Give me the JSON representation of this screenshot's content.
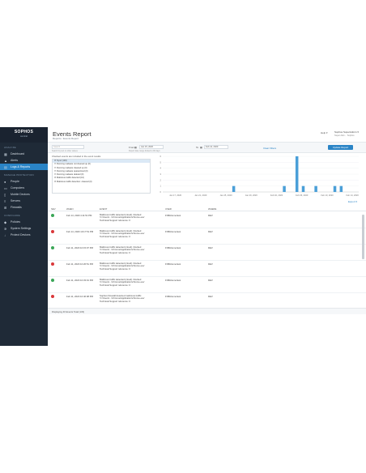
{
  "app": {
    "brand": "SOPHOS",
    "brand_sub": "central"
  },
  "sidebar": {
    "section1": "ANALYZE",
    "section2": "MANAGE PROTECTION",
    "section3": "CONFIGURE",
    "items": [
      {
        "label": "Dashboard",
        "icon": "dashboard-icon",
        "active": false
      },
      {
        "label": "Alerts",
        "icon": "alert-icon",
        "active": false
      },
      {
        "label": "Logs & Reports",
        "icon": "reports-icon",
        "active": true
      },
      {
        "label": "People",
        "icon": "people-icon",
        "active": false
      },
      {
        "label": "Computers",
        "icon": "computer-icon",
        "active": false
      },
      {
        "label": "Mobile Devices",
        "icon": "mobile-icon",
        "active": false
      },
      {
        "label": "Servers",
        "icon": "server-icon",
        "active": false
      },
      {
        "label": "Firewalls",
        "icon": "firewall-icon",
        "active": false
      },
      {
        "label": "Policies",
        "icon": "policy-icon",
        "active": false
      },
      {
        "label": "System Settings",
        "icon": "gear-icon",
        "active": false
      },
      {
        "label": "Protect Devices",
        "icon": "download-icon",
        "active": false
      }
    ]
  },
  "header": {
    "title": "Events Report",
    "crumb1": "Reports",
    "crumb2": "Events Report",
    "help": "Help ▾",
    "user": "Sophos SuperAdmin ▾",
    "user_role": "Super Adm... Sophos"
  },
  "filters": {
    "search_placeholder": "Search",
    "search_hint": "Search by text or other values",
    "from_label": "From",
    "from_date": "Jan 15, 2020",
    "to_label": "To",
    "to_date": "Feb 14, 2020",
    "range_hint": "Report date range limited to 90 days",
    "clear": "Clear Filters",
    "update_button": "Update Report"
  },
  "event_types": {
    "heading": "Checked events are included in the event results",
    "items": [
      {
        "label": "Sync (133)",
        "selected": true
      },
      {
        "label": "Running malware not cleaned up (0)",
        "selected": false
      },
      {
        "label": "Running malware cleaned up (0)",
        "selected": false
      },
      {
        "label": "Running malware quarantined (0)",
        "selected": false
      },
      {
        "label": "Running malware deleted (0)",
        "selected": false
      },
      {
        "label": "Malicious traffic detected (10)",
        "selected": false
      },
      {
        "label": "Malicious traffic detection: cleaned (0)",
        "selected": false
      }
    ]
  },
  "chart_data": {
    "type": "bar",
    "ylim": [
      0,
      6
    ],
    "yticks": [
      "6",
      "5",
      "4",
      "3",
      "2",
      "1",
      "0"
    ],
    "tick_labels": [
      "Jan 17, 2020",
      "Jan 21, 2020",
      "Jan 25, 2020",
      "Jan 29, 2020",
      "Feb 02, 2020",
      "Feb 06, 2020",
      "Feb 10, 2020",
      "Feb 14, 2020"
    ],
    "values": [
      {
        "x": "Jan 26, 2020",
        "y": 1
      },
      {
        "x": "Feb 03, 2020",
        "y": 1
      },
      {
        "x": "Feb 05, 2020",
        "y": 6
      },
      {
        "x": "Feb 06, 2020",
        "y": 1
      },
      {
        "x": "Feb 08, 2020",
        "y": 1
      },
      {
        "x": "Feb 11, 2020",
        "y": 1
      },
      {
        "x": "Feb 12, 2020",
        "y": 1
      }
    ],
    "bar_color": "#4a9fd8",
    "grid": true
  },
  "table": {
    "refresh": "Export ▾",
    "columns": [
      "SEV",
      "WHEN",
      "EVENT",
      "USER",
      "WHERE"
    ],
    "rows": [
      {
        "status": "green",
        "when": "Feb 14, 2020 4:11:51 PM",
        "event": "Malicious traffic detected (cloud). blocked 'C:\\Users\\...\\Chrome\\Application\\chrome.exe' Technical Support reference: 0",
        "user": "FNB-Demo\\test",
        "where": "DEV"
      },
      {
        "status": "red",
        "when": "Feb 14, 2020 10:17:51 PM",
        "event": "Malicious traffic detected (cloud). blocked 'C:\\Users\\...\\Chrome\\Application\\chrome.exe' Technical Support reference: 0",
        "user": "FNB-Demo\\test",
        "where": "DEV"
      },
      {
        "status": "green",
        "when": "Feb 11, 2020 10:15:07 PM",
        "event": "Malicious traffic detected (cloud). blocked 'C:\\Users\\...\\Chrome\\Application\\chrome.exe' Technical Support reference: 0",
        "user": "FNB-Demo\\test",
        "where": "DEV"
      },
      {
        "status": "red",
        "when": "Feb 11, 2020 10:26:51 PM",
        "event": "Malicious traffic detected (cloud). blocked 'C:\\Users\\...\\Chrome\\Application\\chrome.exe' Technical Support reference: 0",
        "user": "FNB-Demo\\test",
        "where": "DEV"
      },
      {
        "status": "green",
        "when": "Feb 11, 2020 10:33:01 PM",
        "event": "Malicious traffic detected (cloud). blocked 'C:\\Users\\...\\Chrome\\Application\\chrome.exe' Technical Support reference: 0",
        "user": "FNB-Demo\\test",
        "where": "DEV"
      },
      {
        "status": "red",
        "when": "Feb 11, 2020 10:46:08 PM",
        "event": "Sophos Firewall detected malicious traffic 'C:\\Users\\...\\Chrome\\Application\\chrome.exe' Technical Support reference: 0",
        "user": "FNB-Demo\\test",
        "where": "DEV"
      }
    ],
    "footer": "Displaying 40 Events Total (133)"
  }
}
